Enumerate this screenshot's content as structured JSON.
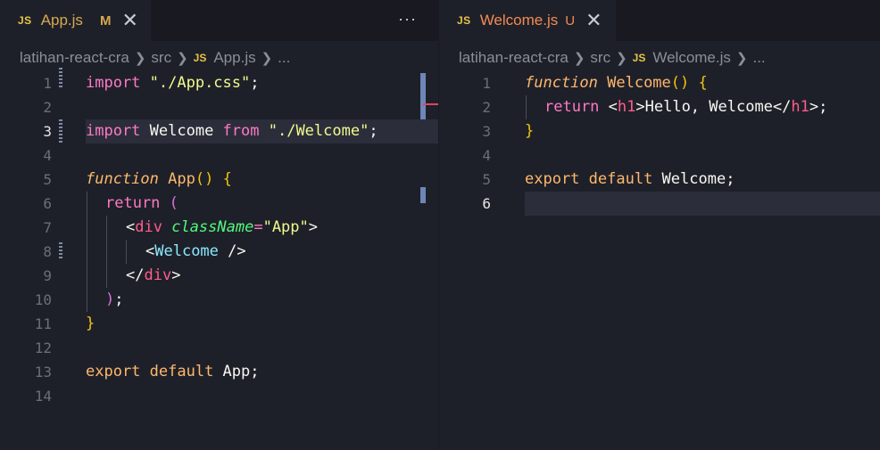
{
  "left": {
    "tab": {
      "js": "JS",
      "name": "App.js",
      "status": "M",
      "close": "✕"
    },
    "more": "···",
    "breadcrumb": [
      "latihan-react-cra",
      "src",
      "App.js",
      "..."
    ],
    "breadcrumb_js": "JS",
    "line_numbers": [
      "1",
      "2",
      "3",
      "4",
      "5",
      "6",
      "7",
      "8",
      "9",
      "10",
      "11",
      "12",
      "13",
      "14"
    ]
  },
  "right": {
    "tab": {
      "js": "JS",
      "name": "Welcome.js",
      "status": "U",
      "close": "✕"
    },
    "breadcrumb": [
      "latihan-react-cra",
      "src",
      "Welcome.js",
      "..."
    ],
    "breadcrumb_js": "JS",
    "line_numbers": [
      "1",
      "2",
      "3",
      "4",
      "5",
      "6"
    ]
  },
  "code": {
    "l1": {
      "a": "import",
      "b": " \"./App.css\"",
      "c": ";"
    },
    "l3": {
      "a": "import",
      "b": " Welcome ",
      "c": "from",
      "d": " \"./Welcome\"",
      "e": ";"
    },
    "l5": {
      "a": "function",
      "b": " App",
      "c": "()",
      "d": " {"
    },
    "l6": {
      "a": "return",
      "b": " ("
    },
    "l7": {
      "a": "<",
      "b": "div",
      "c": " className",
      "d": "=",
      "e": "\"App\"",
      "f": ">"
    },
    "l8": {
      "a": "<",
      "b": "Welcome",
      "c": " />"
    },
    "l9": {
      "a": "</",
      "b": "div",
      "c": ">"
    },
    "l10": {
      "a": ")",
      "b": ";"
    },
    "l11": {
      "a": "}"
    },
    "l13": {
      "a": "export",
      "b": " default",
      "c": " App;"
    },
    "r1": {
      "a": "function",
      "b": " Welcome",
      "c": "()",
      "d": " {"
    },
    "r2": {
      "a": "return",
      "b": " <",
      "c": "h1",
      "d": ">Hello, Welcome</",
      "e": "h1",
      "f": ">;"
    },
    "r3": {
      "a": "}"
    },
    "r5": {
      "a": "export",
      "b": " default",
      "c": " Welcome;"
    }
  },
  "colors": {
    "background": "#1e2029",
    "tabbar": "#191a21",
    "keyword": "#ff79c6",
    "string": "#f1fa8c",
    "accent": "#ffb86c"
  }
}
